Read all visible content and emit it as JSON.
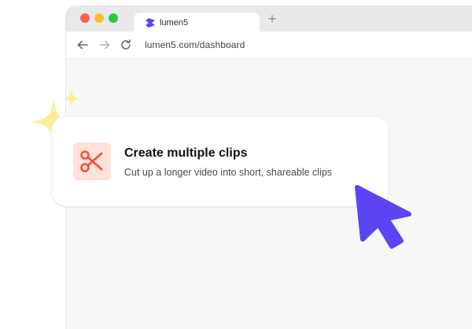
{
  "browser": {
    "tab": {
      "title": "lumen5"
    },
    "new_tab_glyph": "+",
    "url": "lumen5.com/dashboard",
    "nav": {
      "back_icon": "arrow-left-icon",
      "forward_icon": "arrow-right-icon",
      "reload_icon": "reload-icon"
    }
  },
  "card": {
    "icon": "scissors-icon",
    "title": "Create multiple clips",
    "subtitle": "Cut up a longer video into short, shareable clips"
  },
  "colors": {
    "accent_purple": "#5b45f2",
    "scissors_red": "#f0533a",
    "icon_bg": "#fde3d8",
    "sparkle_yellow": "#fbec9a"
  }
}
